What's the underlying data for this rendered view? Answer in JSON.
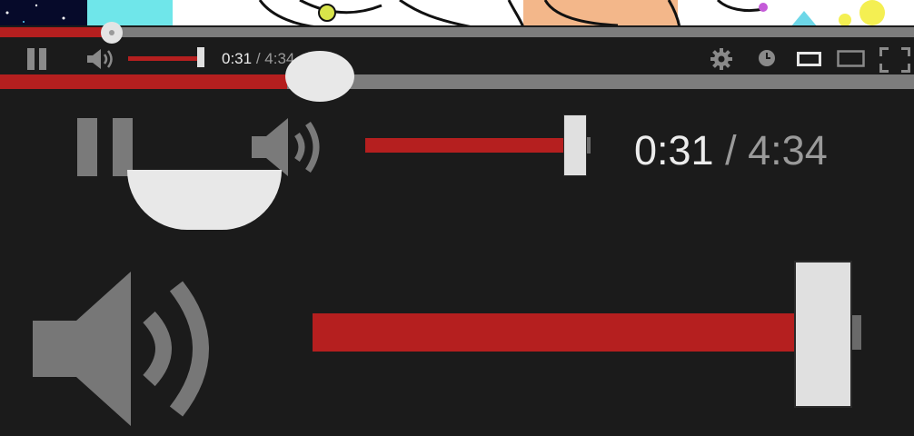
{
  "player": {
    "current_time": "0:31",
    "separator": "/",
    "duration": "4:34",
    "progress_fraction": 0.116,
    "volume_fraction": 1.0,
    "icons": {
      "play_pause": "pause-icon",
      "volume": "volume-icon",
      "settings": "gear-icon",
      "watch_later": "clock-icon",
      "small_player": "small-player-icon",
      "theater": "theater-mode-icon",
      "fullscreen": "fullscreen-icon"
    }
  },
  "colors": {
    "accent": "#b51f1f",
    "bar_bg": "#1b1b1b",
    "track": "#7d7d7d",
    "icon": "#8a8a8a",
    "handle": "#e0e0e0"
  }
}
